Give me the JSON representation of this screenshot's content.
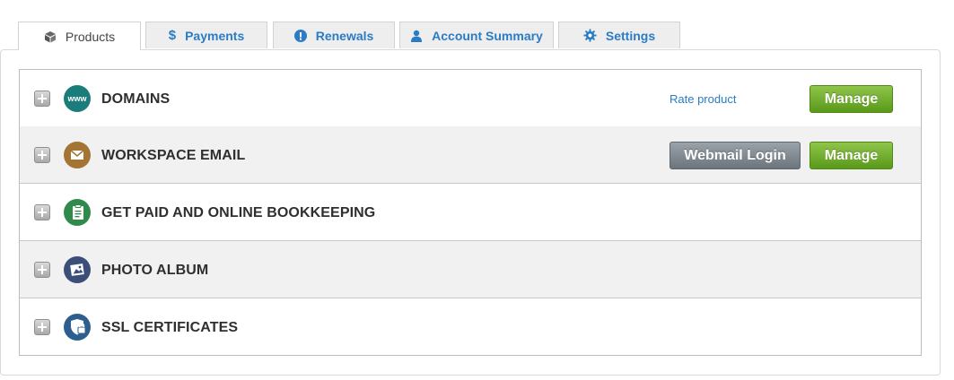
{
  "tabs": [
    {
      "label": "Products",
      "icon": "box-icon",
      "active": true
    },
    {
      "label": "Payments",
      "icon": "dollar-icon",
      "active": false
    },
    {
      "label": "Renewals",
      "icon": "alert-icon",
      "active": false
    },
    {
      "label": "Account Summary",
      "icon": "user-icon",
      "active": false
    },
    {
      "label": "Settings",
      "icon": "gear-icon",
      "active": false
    }
  ],
  "products": [
    {
      "name": "DOMAINS",
      "icon": "www-globe-icon",
      "icon_color": "#1a7d7c",
      "rate_label": "Rate product",
      "manage_label": "Manage"
    },
    {
      "name": "WORKSPACE EMAIL",
      "icon": "envelope-icon",
      "icon_color": "#a37433",
      "webmail_label": "Webmail Login",
      "manage_label": "Manage"
    },
    {
      "name": "GET PAID AND ONLINE BOOKKEEPING",
      "icon": "clipboard-icon",
      "icon_color": "#2f8a4c"
    },
    {
      "name": "PHOTO ALBUM",
      "icon": "photo-icon",
      "icon_color": "#3a4e78"
    },
    {
      "name": "SSL CERTIFICATES",
      "icon": "ssl-lock-icon",
      "icon_color": "#2c5f8f"
    }
  ],
  "colors": {
    "link": "#2b7bc5",
    "button_green": "#6aab24",
    "button_gray": "#7d868c",
    "row_alt": "#f1f1f1"
  }
}
